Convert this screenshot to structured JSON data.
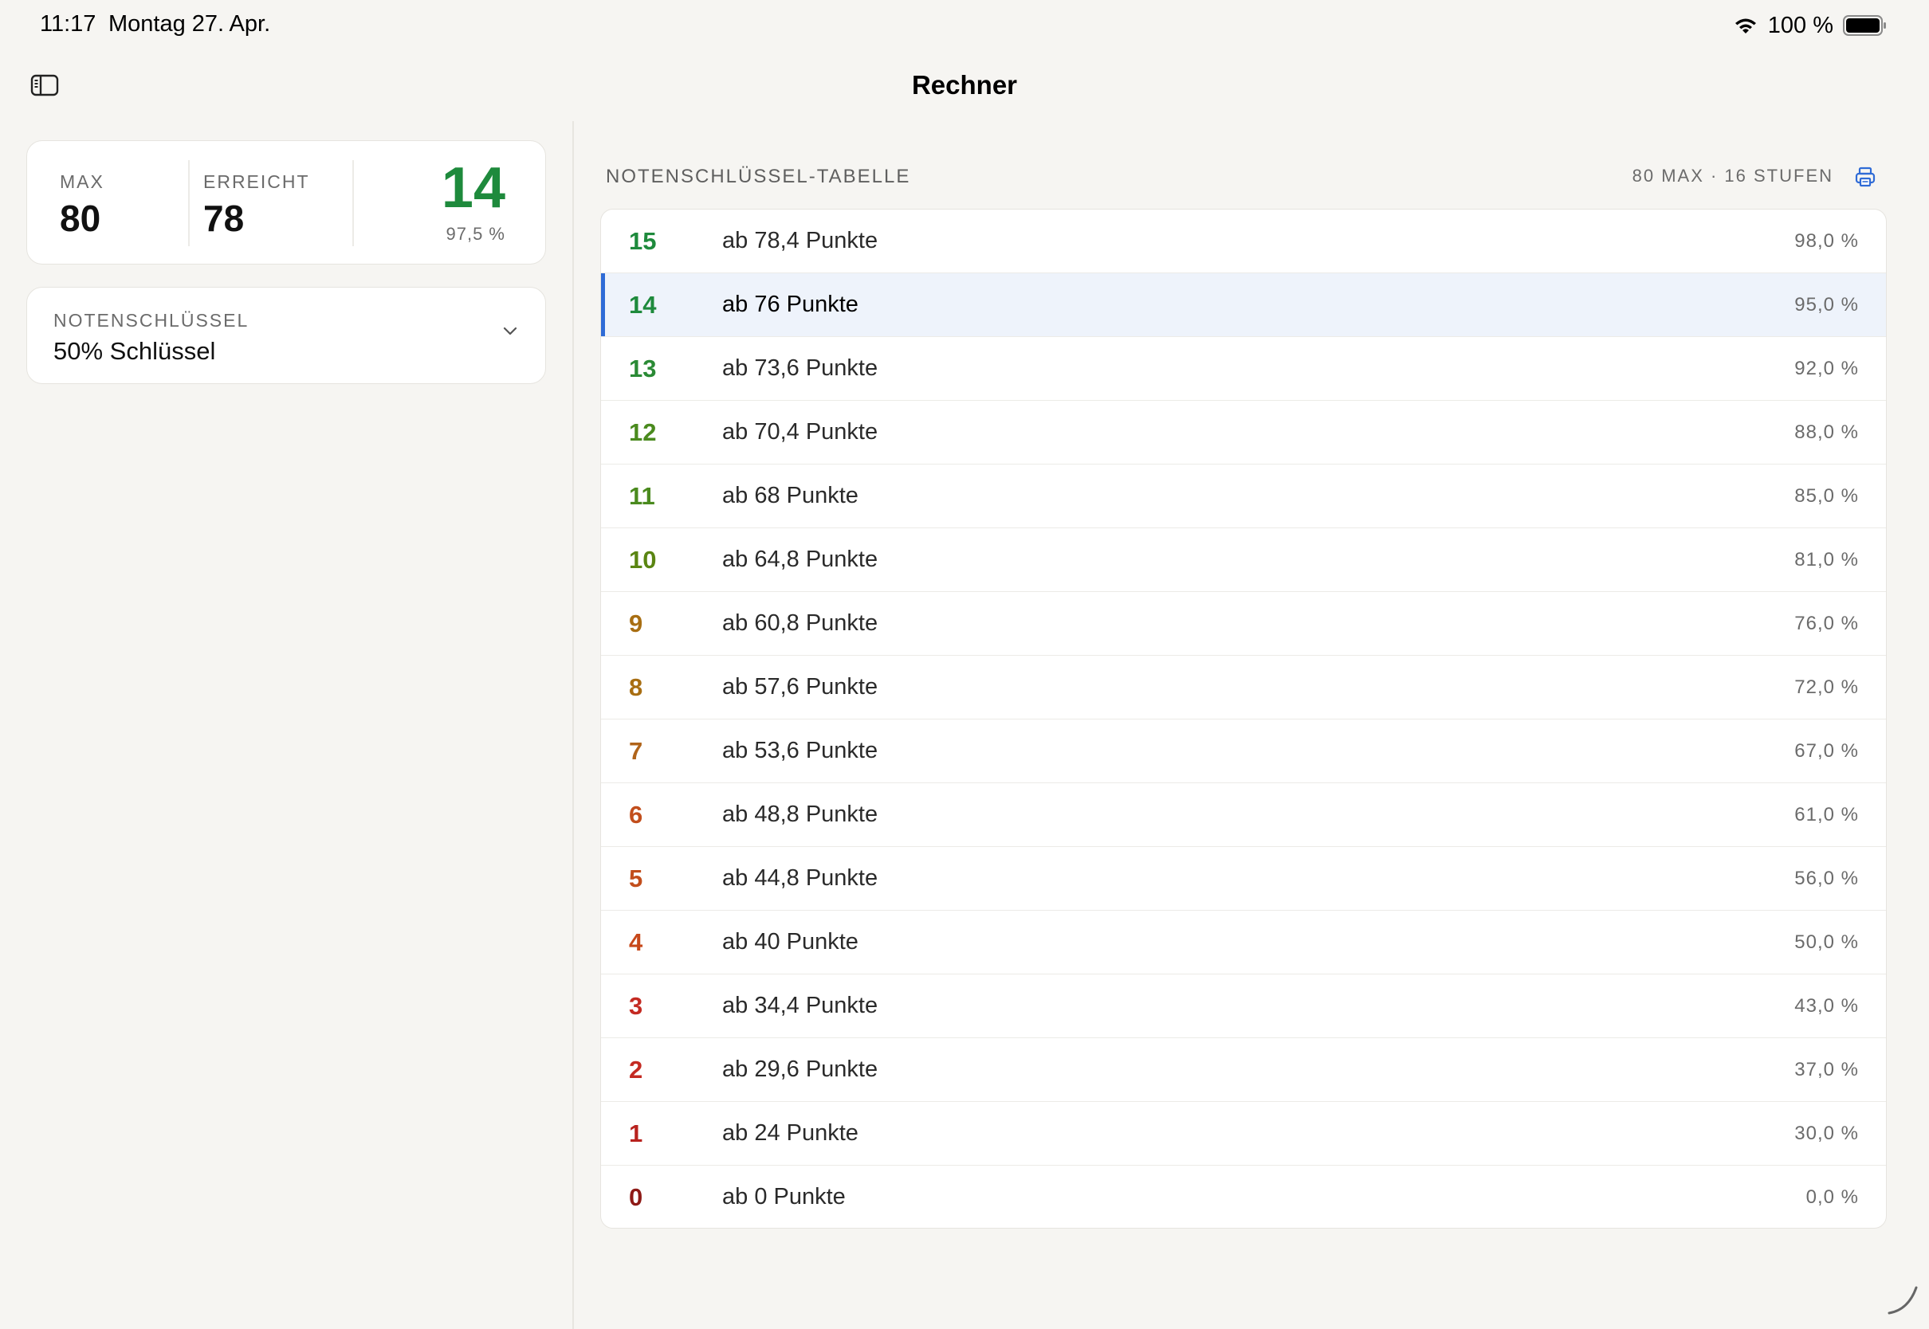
{
  "status_bar": {
    "time": "11:17",
    "date": "Montag 27. Apr.",
    "battery_text": "100 %",
    "icons": [
      "wifi-icon",
      "battery-icon"
    ]
  },
  "nav": {
    "title": "Rechner",
    "sidebar_toggle_icon": "sidebar-icon"
  },
  "score_card": {
    "max_label": "MAX",
    "max_value": "80",
    "achieved_label": "ERREICHT",
    "achieved_value": "78",
    "grade": "14",
    "percent": "97,5 %",
    "grade_color": "#1e8a3c"
  },
  "grading_key": {
    "label": "NOTENSCHLÜSSEL",
    "value": "50% Schlüssel",
    "chevron_icon": "chevron-down-icon"
  },
  "table": {
    "title": "NOTENSCHLÜSSEL-TABELLE",
    "meta": "80 MAX · 16 STUFEN",
    "print_icon": "print-icon",
    "highlight_color": "#2f6bd6",
    "rows": [
      {
        "grade": "15",
        "threshold": "ab 78,4 Punkte",
        "percent": "98,0 %",
        "color": "#1e8a3c"
      },
      {
        "grade": "14",
        "threshold": "ab 76 Punkte",
        "percent": "95,0 %",
        "color": "#1e8a3c"
      },
      {
        "grade": "13",
        "threshold": "ab 73,6 Punkte",
        "percent": "92,0 %",
        "color": "#2a8a35"
      },
      {
        "grade": "12",
        "threshold": "ab 70,4 Punkte",
        "percent": "88,0 %",
        "color": "#4a8a1e"
      },
      {
        "grade": "11",
        "threshold": "ab 68 Punkte",
        "percent": "85,0 %",
        "color": "#4a8a1e"
      },
      {
        "grade": "10",
        "threshold": "ab 64,8 Punkte",
        "percent": "81,0 %",
        "color": "#5a8512"
      },
      {
        "grade": "9",
        "threshold": "ab 60,8 Punkte",
        "percent": "76,0 %",
        "color": "#a86e12"
      },
      {
        "grade": "8",
        "threshold": "ab 57,6 Punkte",
        "percent": "72,0 %",
        "color": "#a86e12"
      },
      {
        "grade": "7",
        "threshold": "ab 53,6 Punkte",
        "percent": "67,0 %",
        "color": "#b0641a"
      },
      {
        "grade": "6",
        "threshold": "ab 48,8 Punkte",
        "percent": "61,0 %",
        "color": "#c24e1c"
      },
      {
        "grade": "5",
        "threshold": "ab 44,8 Punkte",
        "percent": "56,0 %",
        "color": "#c24e1c"
      },
      {
        "grade": "4",
        "threshold": "ab 40 Punkte",
        "percent": "50,0 %",
        "color": "#c7481a"
      },
      {
        "grade": "3",
        "threshold": "ab 34,4 Punkte",
        "percent": "43,0 %",
        "color": "#c42a22"
      },
      {
        "grade": "2",
        "threshold": "ab 29,6 Punkte",
        "percent": "37,0 %",
        "color": "#c42a22"
      },
      {
        "grade": "1",
        "threshold": "ab 24 Punkte",
        "percent": "30,0 %",
        "color": "#b8221e"
      },
      {
        "grade": "0",
        "threshold": "ab 0 Punkte",
        "percent": "0,0 %",
        "color": "#8e1a16"
      }
    ],
    "highlighted_row": 1
  }
}
